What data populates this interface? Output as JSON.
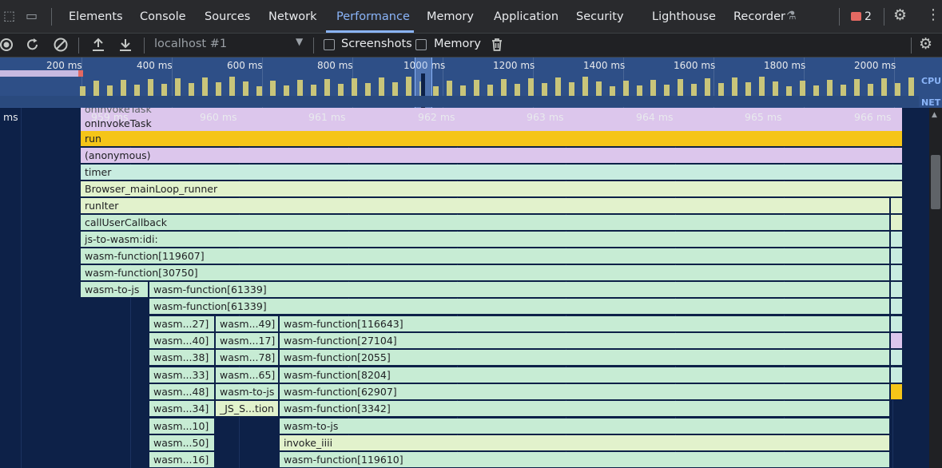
{
  "tabs": [
    "Elements",
    "Console",
    "Sources",
    "Network",
    "Performance",
    "Memory",
    "Application",
    "Security",
    "Lighthouse",
    "Recorder"
  ],
  "active_tab": "Performance",
  "issues_count": "2",
  "toolbar": {
    "target": "localhost #1",
    "screenshots_label": "Screenshots",
    "memory_label": "Memory"
  },
  "overview": {
    "ticks": [
      "200 ms",
      "400 ms",
      "600 ms",
      "800 ms",
      "1000 ms",
      "1200 ms",
      "1400 ms",
      "1600 ms",
      "1800 ms",
      "2000 ms"
    ],
    "cpu_label": "CPU",
    "net_label": "NET"
  },
  "ruler": {
    "unit": "ms",
    "ticks": [
      "959 ms",
      "960 ms",
      "961 ms",
      "962 ms",
      "963 ms",
      "964 ms",
      "965 ms",
      "966 ms"
    ]
  },
  "flame": {
    "top_clipped": "onInvokeTask",
    "row0": "onInvokeTask",
    "row1": "run",
    "row2": "(anonymous)",
    "row3": "timer",
    "row4": "Browser_mainLoop_runner",
    "row5": "runIter",
    "row6": "callUserCallback",
    "row7": "js-to-wasm:idi:",
    "row8": "wasm-function[119607]",
    "row9": "wasm-function[30750]",
    "row10a": "wasm-to-js",
    "row10b": "wasm-function[61339]",
    "row11": "wasm-function[61339]",
    "row12": [
      "wasm...27]",
      "wasm...49]",
      "wasm-function[116643]"
    ],
    "row13": [
      "wasm...40]",
      "wasm...17]",
      "wasm-function[27104]"
    ],
    "row14": [
      "wasm...38]",
      "wasm...78]",
      "wasm-function[2055]"
    ],
    "row15": [
      "wasm...33]",
      "wasm...65]",
      "wasm-function[8204]"
    ],
    "row16": [
      "wasm...48]",
      "wasm-to-js",
      "wasm-function[62907]"
    ],
    "row17": [
      "wasm...34]",
      "_JS_S...tion",
      "wasm-function[3342]"
    ],
    "row18": [
      "wasm...10]",
      "wasm-to-js"
    ],
    "row19": [
      "wasm...50]",
      "invoke_iiii"
    ],
    "row20": [
      "wasm...16]",
      "wasm-function[119610]"
    ]
  },
  "colors": {
    "run": "#f5c518",
    "green": "#c7ecd4",
    "yellowgreen": "#e2f2cc",
    "lavender": "#dcc6ec",
    "mint": "#c8ece0",
    "accent": "#8ab4f8"
  }
}
